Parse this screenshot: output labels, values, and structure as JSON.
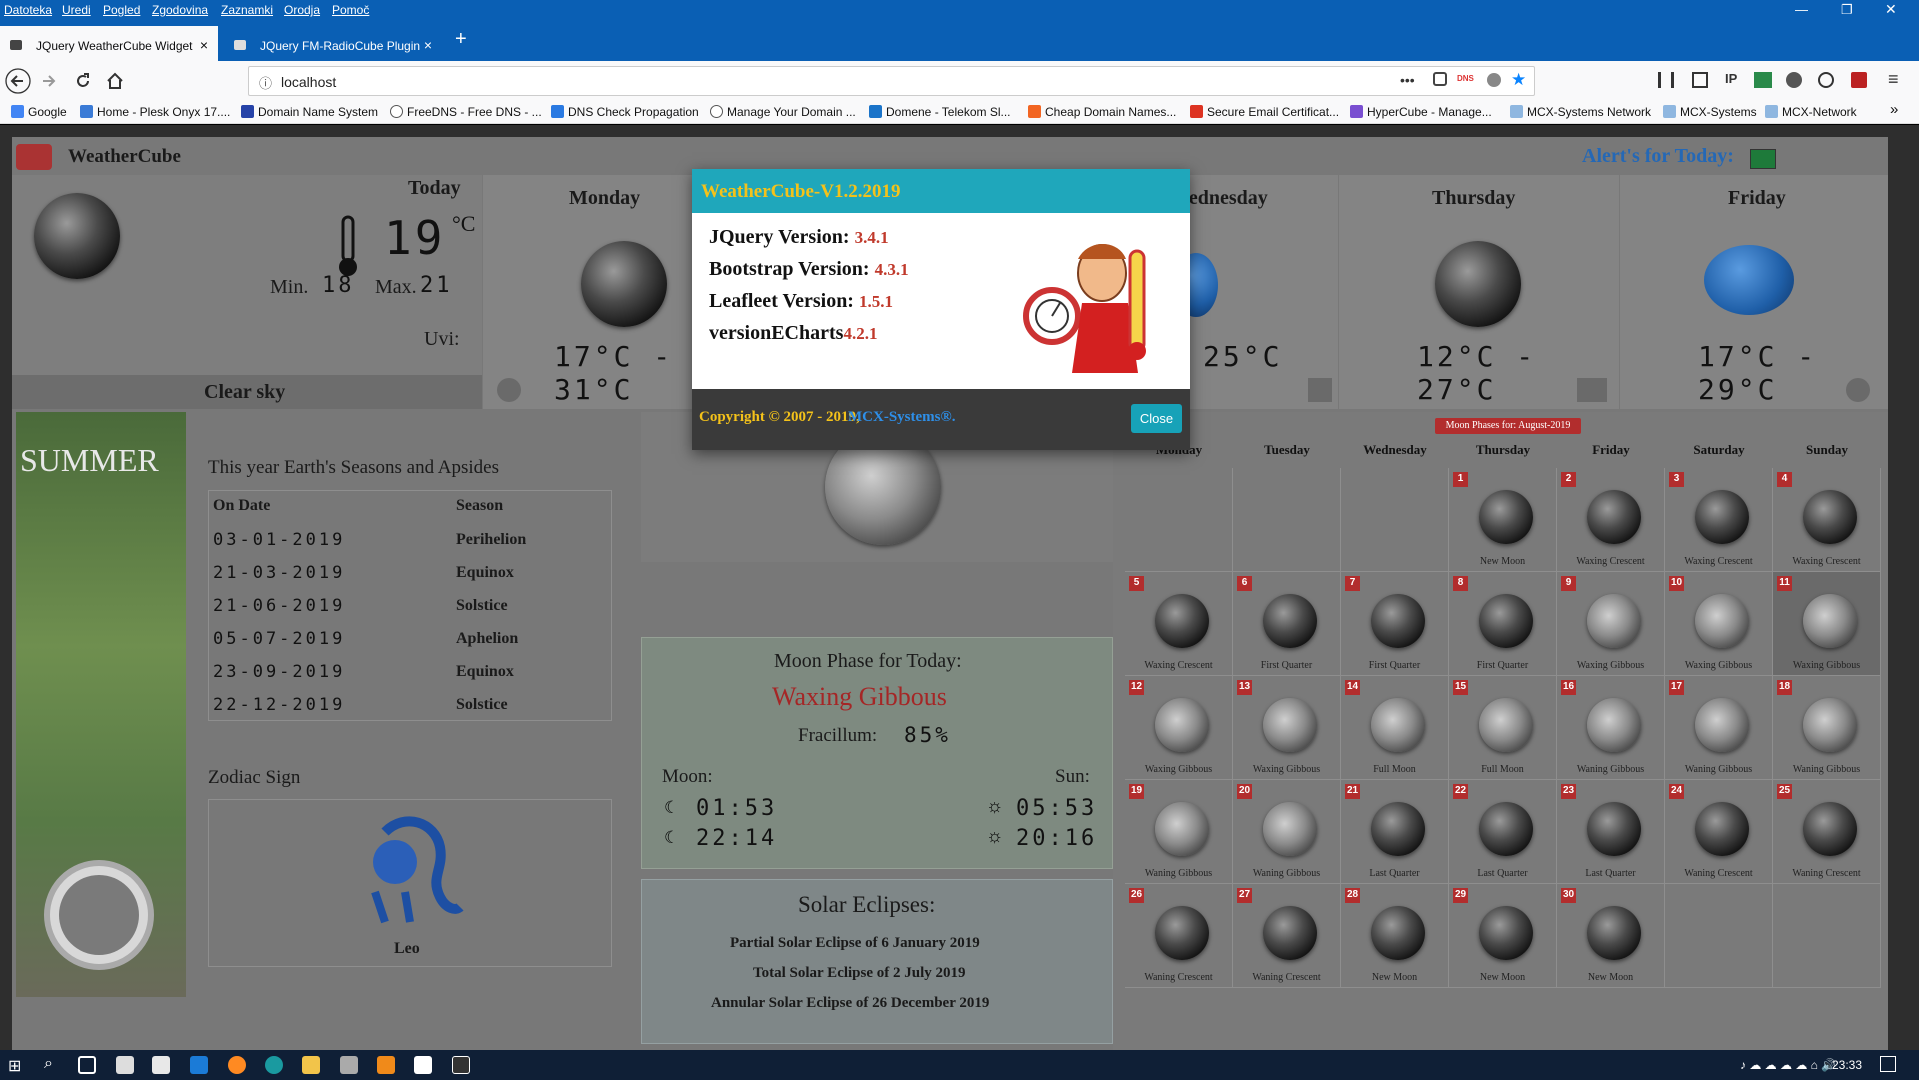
{
  "menu": [
    "Datoteka",
    "Uredi",
    "Pogled",
    "Zgodovina",
    "Zaznamki",
    "Orodja",
    "Pomoč"
  ],
  "tabs": [
    {
      "label": "JQuery WeatherCube Widget",
      "close": "×"
    },
    {
      "label": "JQuery FM-RadioCube Plugin",
      "close": "×"
    }
  ],
  "new_tab": "+",
  "url": "localhost",
  "url_dots": "•••",
  "bookmarks": [
    "Google",
    "Home - Plesk Onyx 17....",
    "Domain Name System",
    "FreeDNS - Free DNS - ...",
    "DNS Check Propagation",
    "Manage Your Domain ...",
    "Domene - Telekom Sl...",
    "Cheap Domain Names...",
    "Secure Email Certificat...",
    "HyperCube - Manage...",
    "MCX-Systems Network",
    "MCX-Systems",
    "MCX-Network"
  ],
  "bookmarks_more": "»",
  "app": {
    "logo": "WeatherCube",
    "alerts": "Alert's for Today:",
    "alert_color": "#1e7a3a",
    "today": {
      "day": "Today",
      "temp": "19",
      "unit": "°C",
      "min_label": "Min.",
      "min": "18",
      "max_label": "Max.",
      "max": "21",
      "uvi": "Uvi:",
      "condition": "Clear sky"
    },
    "forecast": [
      {
        "day": "Monday",
        "range": "17°C - 31°C"
      },
      {
        "day": "Wednesday",
        "range": "25°C"
      },
      {
        "day": "Thursday",
        "range": "12°C - 27°C"
      },
      {
        "day": "Friday",
        "range": "17°C - 29°C"
      }
    ],
    "season_banner": "SUMMER",
    "seasons_title": "This year Earth's Seasons and Apsides",
    "seasons_headers": [
      "On Date",
      "Season"
    ],
    "seasons": [
      [
        "03-01-2019",
        "Perihelion"
      ],
      [
        "21-03-2019",
        "Equinox"
      ],
      [
        "21-06-2019",
        "Solstice"
      ],
      [
        "05-07-2019",
        "Aphelion"
      ],
      [
        "23-09-2019",
        "Equinox"
      ],
      [
        "22-12-2019",
        "Solstice"
      ]
    ],
    "zodiac_title": "Zodiac Sign",
    "zodiac": "Leo",
    "moon_today": {
      "title": "Moon Phase for Today:",
      "phase": "Waxing Gibbous",
      "fracillum_label": "Fracillum:",
      "fracillum": "85%",
      "moon_label": "Moon:",
      "sun_label": "Sun:",
      "moonrise": "01:53",
      "moonset": "22:14",
      "sunrise": "05:53",
      "sunset": "20:16"
    },
    "eclipses": {
      "title": "Solar Eclipses:",
      "items": [
        "Partial Solar Eclipse of 6 January 2019",
        "Total Solar Eclipse of 2 July 2019",
        "Annular Solar Eclipse of 26 December 2019"
      ]
    },
    "calendar": {
      "badge": "Moon Phases for: August-2019",
      "weekdays": [
        "Monday",
        "Tuesday",
        "Wednesday",
        "Thursday",
        "Friday",
        "Saturday",
        "Sunday"
      ],
      "days": [
        {
          "d": "1",
          "p": "New Moon"
        },
        {
          "d": "2",
          "p": "Waxing Crescent"
        },
        {
          "d": "3",
          "p": "Waxing Crescent"
        },
        {
          "d": "4",
          "p": "Waxing Crescent"
        },
        {
          "d": "5",
          "p": "Waxing Crescent"
        },
        {
          "d": "6",
          "p": "First Quarter"
        },
        {
          "d": "7",
          "p": "First Quarter"
        },
        {
          "d": "8",
          "p": "First Quarter"
        },
        {
          "d": "9",
          "p": "Waxing Gibbous"
        },
        {
          "d": "10",
          "p": "Waxing Gibbous"
        },
        {
          "d": "11",
          "p": "Waxing Gibbous"
        },
        {
          "d": "12",
          "p": "Waxing Gibbous"
        },
        {
          "d": "13",
          "p": "Waxing Gibbous"
        },
        {
          "d": "14",
          "p": "Full Moon"
        },
        {
          "d": "15",
          "p": "Full Moon"
        },
        {
          "d": "16",
          "p": "Waning Gibbous"
        },
        {
          "d": "17",
          "p": "Waning Gibbous"
        },
        {
          "d": "18",
          "p": "Waning Gibbous"
        },
        {
          "d": "19",
          "p": "Waning Gibbous"
        },
        {
          "d": "20",
          "p": "Waning Gibbous"
        },
        {
          "d": "21",
          "p": "Last Quarter"
        },
        {
          "d": "22",
          "p": "Last Quarter"
        },
        {
          "d": "23",
          "p": "Last Quarter"
        },
        {
          "d": "24",
          "p": "Waning Crescent"
        },
        {
          "d": "25",
          "p": "Waning Crescent"
        },
        {
          "d": "26",
          "p": "Waning Crescent"
        },
        {
          "d": "27",
          "p": "Waning Crescent"
        },
        {
          "d": "28",
          "p": "New Moon"
        },
        {
          "d": "29",
          "p": "New Moon"
        },
        {
          "d": "30",
          "p": "New Moon"
        }
      ]
    }
  },
  "modal": {
    "title": "WeatherCube-V1.2.2019",
    "rows": [
      {
        "label": "JQuery Version: ",
        "value": "3.4.1"
      },
      {
        "label": "Bootstrap Version: ",
        "value": "4.3.1"
      },
      {
        "label": "Leafleet Version: ",
        "value": "1.5.1"
      },
      {
        "label": "versionECharts",
        "value": "4.2.1"
      }
    ],
    "copyright": "Copyright © 2007 - 2019, ",
    "company": "MCX-Systems®.",
    "close": "Close"
  },
  "taskbar": {
    "time": "23:33"
  }
}
